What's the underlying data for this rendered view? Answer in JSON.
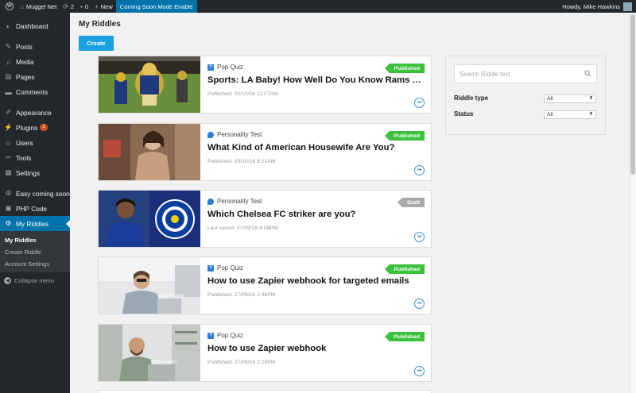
{
  "adminbar": {
    "site_name": "Muggel Net",
    "updates": "2",
    "comments": "0",
    "new_label": "New",
    "coming_soon": "Coming Soon Mode Enable",
    "howdy": "Howdy, Mike Hawkins"
  },
  "sidebar": {
    "items": [
      {
        "label": "Dashboard",
        "icon": "dashboard-icon"
      },
      {
        "label": "Posts",
        "icon": "pin-icon"
      },
      {
        "label": "Media",
        "icon": "media-icon"
      },
      {
        "label": "Pages",
        "icon": "pages-icon"
      },
      {
        "label": "Comments",
        "icon": "comment-icon"
      },
      {
        "label": "Appearance",
        "icon": "brush-icon"
      },
      {
        "label": "Plugins",
        "icon": "plugin-icon",
        "badge": "1"
      },
      {
        "label": "Users",
        "icon": "users-icon"
      },
      {
        "label": "Tools",
        "icon": "wrench-icon"
      },
      {
        "label": "Settings",
        "icon": "settings-icon"
      },
      {
        "label": "Easy coming soon",
        "icon": "gear-icon"
      },
      {
        "label": "PHP Code",
        "icon": "code-icon"
      },
      {
        "label": "My Riddles",
        "icon": "gear-icon"
      }
    ],
    "submenu": [
      "My Riddles",
      "Create Riddle",
      "Account Settings"
    ],
    "collapse": "Collapse menu"
  },
  "main": {
    "title": "My Riddles",
    "create_label": "Create"
  },
  "riddles": [
    {
      "type": "Pop Quiz",
      "title": "Sports: LA Baby! How Well Do You Know Rams His...",
      "date": "Published: 03/10/16 11:07AM",
      "status": "Published"
    },
    {
      "type": "Personality Test",
      "title": "What Kind of American Housewife Are You?",
      "date": "Published: 03/10/16 8:21AM",
      "status": "Published"
    },
    {
      "type": "Personality Test",
      "title": "Which Chelsea FC striker are you?",
      "date": "Last saved: 27/09/16 4:08PM",
      "status": "Draft"
    },
    {
      "type": "Pop Quiz",
      "title": "How to use Zapier webhook for targeted emails",
      "date": "Published: 27/09/16 2:46PM",
      "status": "Published"
    },
    {
      "type": "Pop Quiz",
      "title": "How to use Zapier webhook",
      "date": "Published: 27/09/16 2:29PM",
      "status": "Published"
    }
  ],
  "filters": {
    "search_placeholder": "Search Riddle text",
    "type_label": "Riddle type",
    "type_value": "All",
    "status_label": "Status",
    "status_value": "All"
  },
  "colors": {
    "accent": "#0073aa",
    "create_button": "#1aa1e1",
    "published": "#3cc13b",
    "draft": "#aaaaaa"
  }
}
